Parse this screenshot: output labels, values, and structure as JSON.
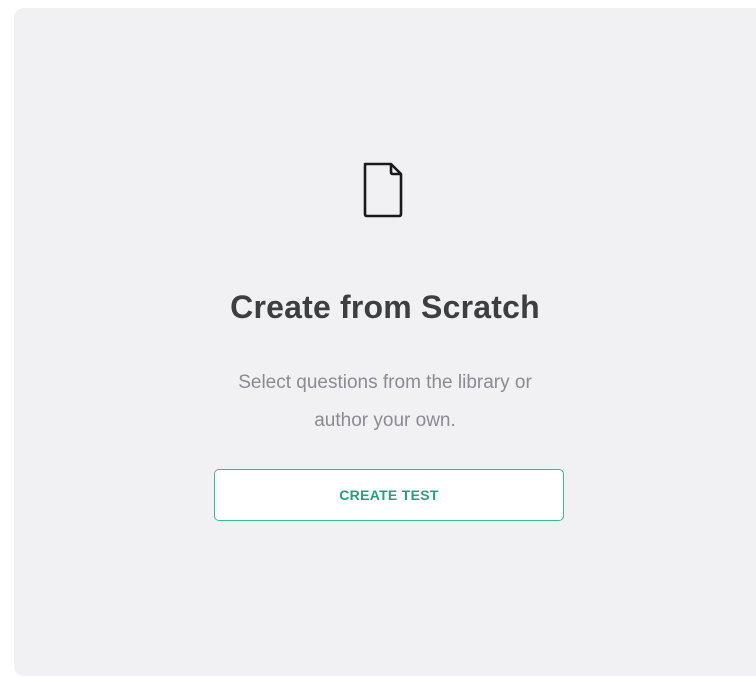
{
  "card": {
    "icon": "document-icon",
    "title": "Create from Scratch",
    "description_line1": "Select questions from the library or",
    "description_line2": "author your own.",
    "button_label": "CREATE TEST",
    "accent_color": "#3dba94",
    "background_color": "#f1f1f3"
  }
}
